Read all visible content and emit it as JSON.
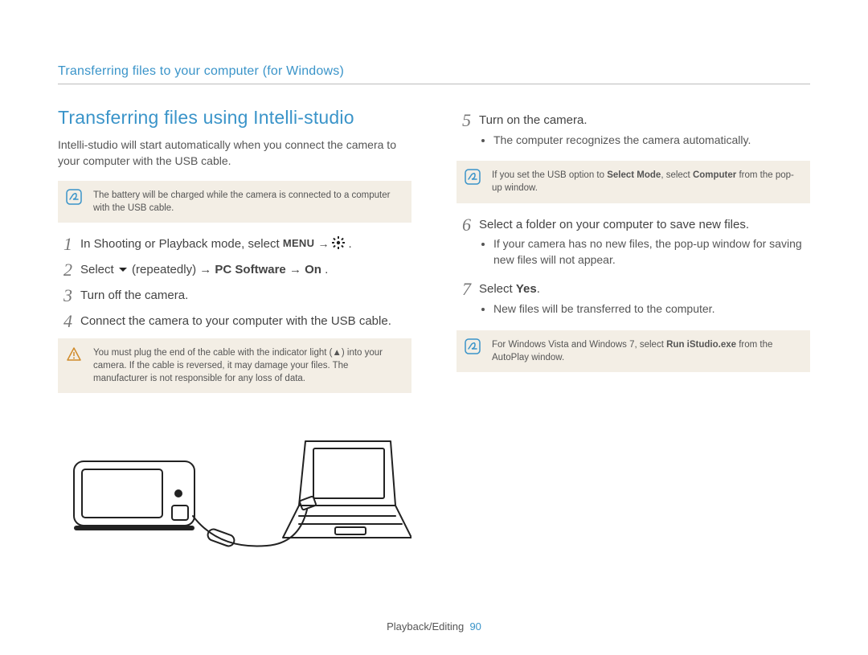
{
  "header": "Transferring files to your computer (for Windows)",
  "section_title": "Transferring files using Intelli-studio",
  "intro": "Intelli-studio will start automatically when you connect the camera to your computer with the USB cable.",
  "note_battery": "The battery will be charged while the camera is connected to a computer with the USB cable.",
  "step1": {
    "pre": "In Shooting or Playback mode, select ",
    "menu": "MENU",
    "arrow1": " → ",
    "post": "."
  },
  "step2": {
    "pre": "Select ",
    "mid1": " (repeatedly) → ",
    "bold1": "PC Software",
    "mid2": " → ",
    "bold2": "On",
    "post": "."
  },
  "step3": "Turn off the camera.",
  "step4": "Connect the camera to your computer with the USB cable.",
  "warn_cable": "You must plug the end of the cable with the indicator light (▲) into your camera. If the cable is reversed, it may damage your files. The manufacturer is not responsible for any loss of data.",
  "step5": {
    "text": "Turn on the camera.",
    "bullet": "The computer recognizes the camera automatically."
  },
  "note_usbopt": {
    "pre": "If you set the USB option to ",
    "b1": "Select Mode",
    "mid": ", select ",
    "b2": "Computer",
    "post": " from the pop-up window."
  },
  "step6": {
    "text": "Select a folder on your computer to save new files.",
    "bullet": "If your camera has no new files, the pop-up window for saving new files will not appear."
  },
  "step7": {
    "pre": "Select ",
    "bold": "Yes",
    "post": ".",
    "bullet": "New files will be transferred to the computer."
  },
  "note_vista": {
    "pre": "For Windows Vista and Windows 7, select ",
    "b1": "Run iStudio.exe",
    "post": " from the AutoPlay window."
  },
  "footer_section": "Playback/Editing",
  "footer_page": "90"
}
